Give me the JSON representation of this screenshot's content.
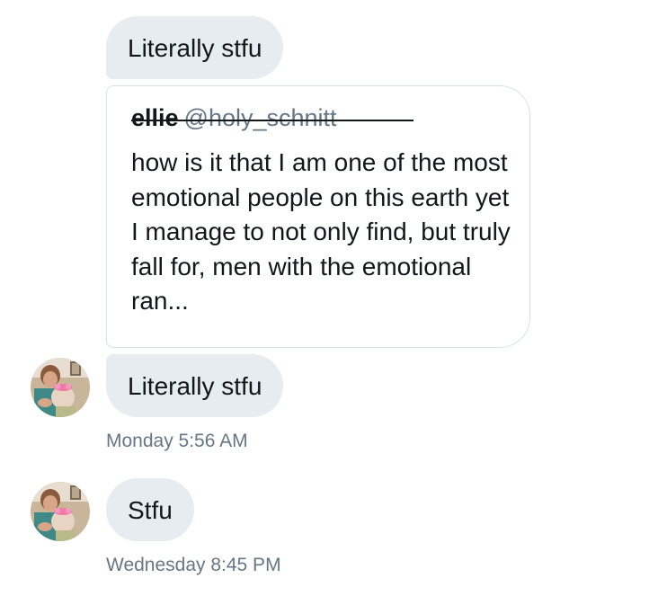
{
  "messages": [
    {
      "text": "Literally stfu"
    },
    {
      "text": "Literally stfu"
    },
    {
      "text": "Stfu"
    }
  ],
  "quoted_tweet": {
    "name": "ellie",
    "handle": "@holy_schnitt",
    "text": "how is it that I am one of the most emotional people on this earth yet I manage to not only find, but truly fall for, men with the emotional ran..."
  },
  "timestamps": [
    "Monday 5:56 AM",
    "Wednesday 8:45 PM"
  ],
  "colors": {
    "bubble_bg": "#e6ecf0",
    "text": "#14171a",
    "secondary_text": "#657786",
    "card_border": "#d9e1e8"
  }
}
